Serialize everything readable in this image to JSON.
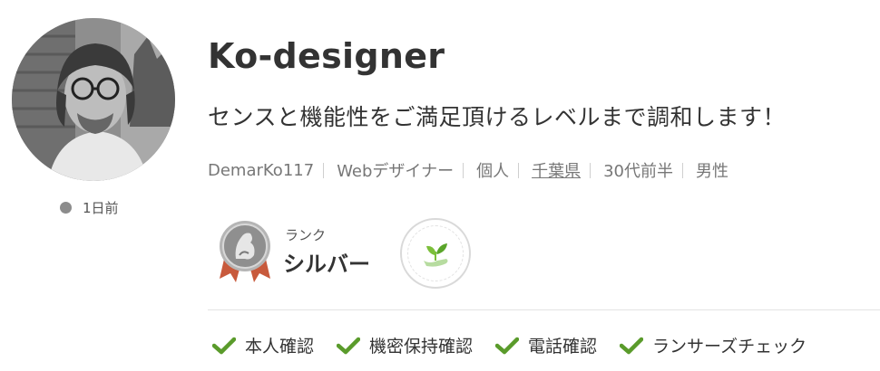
{
  "profile": {
    "username": "Ko-designer",
    "tagline": "センスと機能性をご満足頂けるレベルまで調和します！",
    "last_login": "1日前",
    "meta": [
      "DemarKo117",
      "Webデザイナー",
      "個人",
      "千葉県",
      "30代前半",
      "男性"
    ]
  },
  "rank": {
    "label": "ランク",
    "value": "シルバー"
  },
  "verifications": [
    "本人確認",
    "機密保持確認",
    "電話確認",
    "ランサーズチェック"
  ],
  "colors": {
    "check": "#5a9b2b",
    "sprout": "#7cbf3a",
    "medal_silver": "#9b9b9b",
    "ribbon": "#c85a3c"
  }
}
